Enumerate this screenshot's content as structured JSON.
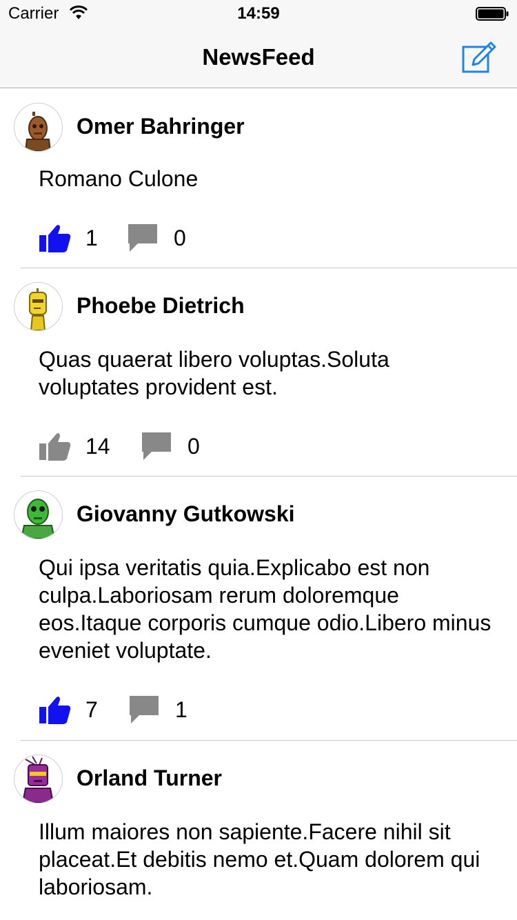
{
  "status": {
    "carrier": "Carrier",
    "time": "14:59"
  },
  "nav": {
    "title": "NewsFeed",
    "compose_icon": "compose-icon"
  },
  "colors": {
    "liked": "#1212f0",
    "inactive": "#888888",
    "accent": "#1f84ea"
  },
  "posts": [
    {
      "author": "Omer Bahringer",
      "body": "Romano Culone",
      "likes": "1",
      "comments": "0",
      "liked": true,
      "avatar": "brown-robot"
    },
    {
      "author": "Phoebe Dietrich",
      "body": "Quas quaerat libero voluptas.Soluta voluptates provident est.",
      "likes": "14",
      "comments": "0",
      "liked": false,
      "avatar": "yellow-robot"
    },
    {
      "author": "Giovanny Gutkowski",
      "body": "Qui ipsa veritatis quia.Explicabo est non culpa.Laboriosam rerum doloremque eos.Itaque corporis cumque odio.Libero minus eveniet voluptate.",
      "likes": "7",
      "comments": "1",
      "liked": true,
      "avatar": "green-robot"
    },
    {
      "author": "Orland Turner",
      "body": "Illum maiores non sapiente.Facere nihil sit placeat.Et debitis nemo et.Quam dolorem qui laboriosam.",
      "likes": "",
      "comments": "",
      "liked": false,
      "avatar": "purple-robot"
    }
  ]
}
